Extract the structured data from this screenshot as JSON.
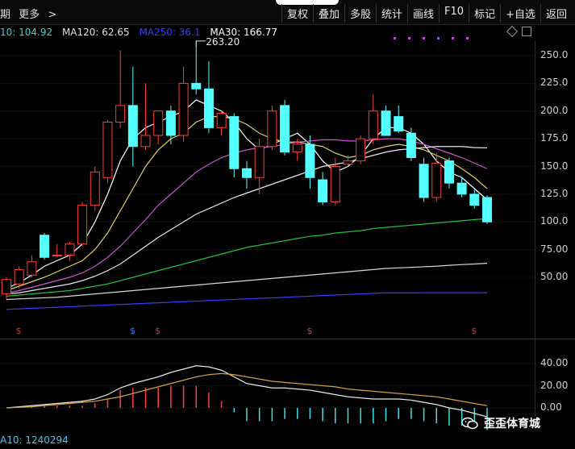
{
  "toolbar": {
    "left_partial": "期",
    "more": "更多",
    "more_chevron": ">",
    "items": [
      "复权",
      "叠加",
      "多股",
      "统计",
      "画线",
      "F10",
      "标记",
      "+自选",
      "返回"
    ]
  },
  "ma_legend": [
    {
      "label": "10: 104.92",
      "color": "#36d2c8"
    },
    {
      "label": "MA120: 62.65",
      "color": "#e0e0e0"
    },
    {
      "label": "MA250: 36.1",
      "color": "#3a3aff"
    },
    {
      "label": "MA30: 166.77",
      "color": "#ffffff"
    }
  ],
  "icons": {
    "diamond": "diamond-icon",
    "square": "square-icon",
    "wechat": "wechat-icon"
  },
  "annotation": {
    "high_label": "263.20"
  },
  "price_axis": [
    "250.0",
    "225.0",
    "200.0",
    "175.0",
    "150.0",
    "125.0",
    "100.0",
    "75.00",
    "50.00"
  ],
  "macd_axis": [
    "40.00",
    "20.00",
    "0.00"
  ],
  "bottom_indicator": "A10: 1240294",
  "watermark": "歪歪体育城",
  "chart_data": {
    "type": "candlestick",
    "ylim": [
      25,
      265
    ],
    "candles": [
      {
        "o": 35,
        "h": 50,
        "l": 30,
        "c": 48
      },
      {
        "o": 44,
        "h": 60,
        "l": 40,
        "c": 57
      },
      {
        "o": 52,
        "h": 70,
        "l": 50,
        "c": 64
      },
      {
        "o": 88,
        "h": 90,
        "l": 66,
        "c": 68
      },
      {
        "o": 70,
        "h": 80,
        "l": 68,
        "c": 70
      },
      {
        "o": 70,
        "h": 82,
        "l": 65,
        "c": 80
      },
      {
        "o": 80,
        "h": 118,
        "l": 78,
        "c": 115
      },
      {
        "o": 115,
        "h": 150,
        "l": 110,
        "c": 145
      },
      {
        "o": 140,
        "h": 192,
        "l": 135,
        "c": 190
      },
      {
        "o": 190,
        "h": 255,
        "l": 185,
        "c": 205
      },
      {
        "o": 205,
        "h": 240,
        "l": 150,
        "c": 168
      },
      {
        "o": 168,
        "h": 225,
        "l": 165,
        "c": 178
      },
      {
        "o": 178,
        "h": 195,
        "l": 170,
        "c": 200
      },
      {
        "o": 200,
        "h": 205,
        "l": 170,
        "c": 178
      },
      {
        "o": 178,
        "h": 240,
        "l": 172,
        "c": 225
      },
      {
        "o": 225,
        "h": 263.2,
        "l": 215,
        "c": 220
      },
      {
        "o": 220,
        "h": 245,
        "l": 180,
        "c": 185
      },
      {
        "o": 185,
        "h": 200,
        "l": 178,
        "c": 198
      },
      {
        "o": 195,
        "h": 198,
        "l": 140,
        "c": 148
      },
      {
        "o": 148,
        "h": 155,
        "l": 130,
        "c": 140
      },
      {
        "o": 140,
        "h": 175,
        "l": 125,
        "c": 168
      },
      {
        "o": 168,
        "h": 205,
        "l": 165,
        "c": 200
      },
      {
        "o": 205,
        "h": 210,
        "l": 160,
        "c": 163
      },
      {
        "o": 163,
        "h": 175,
        "l": 155,
        "c": 170
      },
      {
        "o": 170,
        "h": 178,
        "l": 130,
        "c": 140
      },
      {
        "o": 138,
        "h": 145,
        "l": 115,
        "c": 118
      },
      {
        "o": 118,
        "h": 158,
        "l": 115,
        "c": 150
      },
      {
        "o": 152,
        "h": 160,
        "l": 150,
        "c": 155
      },
      {
        "o": 155,
        "h": 178,
        "l": 152,
        "c": 175
      },
      {
        "o": 175,
        "h": 215,
        "l": 170,
        "c": 200
      },
      {
        "o": 200,
        "h": 205,
        "l": 178,
        "c": 178
      },
      {
        "o": 195,
        "h": 205,
        "l": 180,
        "c": 182
      },
      {
        "o": 180,
        "h": 185,
        "l": 155,
        "c": 158
      },
      {
        "o": 152,
        "h": 158,
        "l": 118,
        "c": 122
      },
      {
        "o": 122,
        "h": 162,
        "l": 118,
        "c": 153
      },
      {
        "o": 155,
        "h": 158,
        "l": 130,
        "c": 135
      },
      {
        "o": 135,
        "h": 140,
        "l": 122,
        "c": 125
      },
      {
        "o": 125,
        "h": 130,
        "l": 112,
        "c": 115
      },
      {
        "o": 122,
        "h": 124,
        "l": 98,
        "c": 100
      }
    ],
    "ma_lines": [
      {
        "name": "MA5",
        "color": "#ffffff",
        "values": [
          40,
          45,
          52,
          60,
          65,
          70,
          80,
          100,
          125,
          155,
          175,
          185,
          190,
          195,
          200,
          210,
          205,
          200,
          190,
          175,
          165,
          170,
          175,
          180,
          170,
          155,
          145,
          150,
          160,
          175,
          185,
          185,
          180,
          170,
          155,
          145,
          140,
          130,
          120
        ]
      },
      {
        "name": "MA10",
        "color": "#e0d060",
        "values": [
          38,
          42,
          46,
          50,
          55,
          60,
          65,
          75,
          90,
          110,
          130,
          150,
          165,
          175,
          180,
          190,
          195,
          195,
          193,
          188,
          180,
          175,
          172,
          172,
          170,
          168,
          162,
          158,
          160,
          165,
          168,
          170,
          168,
          165,
          160,
          155,
          148,
          140,
          130
        ]
      },
      {
        "name": "MA20",
        "color": "#d050d0",
        "values": [
          36,
          38,
          41,
          44,
          47,
          50,
          54,
          60,
          68,
          78,
          90,
          102,
          115,
          125,
          135,
          145,
          152,
          158,
          162,
          165,
          167,
          168,
          170,
          172,
          173,
          174,
          174,
          173,
          173,
          174,
          175,
          175,
          173,
          170,
          166,
          162,
          158,
          153,
          148
        ]
      },
      {
        "name": "MA30",
        "color": "#e8e8e8",
        "values": [
          35,
          36,
          38,
          40,
          42,
          44,
          47,
          51,
          56,
          62,
          70,
          78,
          86,
          93,
          100,
          107,
          112,
          117,
          122,
          126,
          130,
          134,
          138,
          142,
          146,
          150,
          152,
          154,
          157,
          160,
          163,
          165,
          166,
          167,
          168,
          168,
          168,
          167,
          166.77
        ]
      },
      {
        "name": "MA60",
        "color": "#20c040",
        "values": [
          33,
          34,
          35,
          36,
          37,
          38,
          40,
          42,
          44,
          47,
          50,
          53,
          56,
          59,
          62,
          65,
          68,
          71,
          74,
          77,
          79,
          81,
          83,
          85,
          87,
          88,
          90,
          91,
          92,
          94,
          95,
          96,
          97,
          98,
          99,
          100,
          101,
          102,
          103
        ]
      },
      {
        "name": "MA120",
        "color": "#d8d8d8",
        "values": [
          30,
          30.5,
          31,
          31.5,
          32,
          33,
          34,
          35,
          36,
          37,
          38,
          39,
          40,
          41,
          42,
          43,
          44,
          45,
          46,
          47,
          48,
          49,
          50,
          51,
          52,
          53,
          54,
          55,
          56,
          57,
          58,
          58.5,
          59,
          59.5,
          60,
          60.8,
          61.5,
          62,
          62.65
        ]
      },
      {
        "name": "MA250",
        "color": "#3a3aff",
        "values": [
          21,
          21.5,
          22,
          22.5,
          23,
          23.5,
          24,
          24.5,
          25,
          25.5,
          26,
          26.5,
          27,
          27.5,
          28,
          28.5,
          29,
          29.5,
          30,
          30.5,
          31,
          31.5,
          32,
          32.5,
          33,
          33.5,
          34,
          34.5,
          35,
          35.5,
          36,
          36,
          36,
          36.1,
          36.1,
          36.1,
          36.1,
          36.1,
          36.1
        ]
      }
    ],
    "macd": {
      "ylim": [
        -25,
        52
      ],
      "dif": [
        0,
        1,
        2,
        3,
        4,
        5,
        6,
        8,
        12,
        18,
        22,
        25,
        28,
        32,
        35,
        38,
        37,
        34,
        28,
        22,
        20,
        18,
        18,
        17,
        16,
        14,
        12,
        10,
        9,
        8,
        8,
        8,
        7,
        5,
        3,
        0,
        -2,
        -5,
        -8
      ],
      "dea": [
        0,
        0.5,
        1,
        2,
        3,
        4,
        5,
        6,
        8,
        10,
        13,
        16,
        19,
        22,
        25,
        28,
        30,
        31,
        30,
        28,
        26,
        24,
        23,
        22,
        21,
        20,
        19,
        17,
        16,
        15,
        14,
        13,
        12,
        11,
        10,
        8,
        6,
        4,
        2
      ],
      "hist": [
        0,
        1,
        2,
        2,
        2,
        2,
        2,
        4,
        8,
        16,
        18,
        18,
        18,
        20,
        20,
        20,
        14,
        6,
        -4,
        -12,
        -12,
        -12,
        -10,
        -10,
        -10,
        -12,
        -14,
        -14,
        -14,
        -14,
        -12,
        -10,
        -10,
        -12,
        -14,
        -16,
        -16,
        -18,
        -20
      ]
    },
    "signal_markers": [
      {
        "index": 1,
        "color": "#e03030"
      },
      {
        "index": 10,
        "color": "#3080ff"
      },
      {
        "index": 12,
        "color": "#e03030"
      },
      {
        "index": 24,
        "color": "#e03030"
      },
      {
        "index": 37,
        "color": "#e03030"
      }
    ]
  }
}
